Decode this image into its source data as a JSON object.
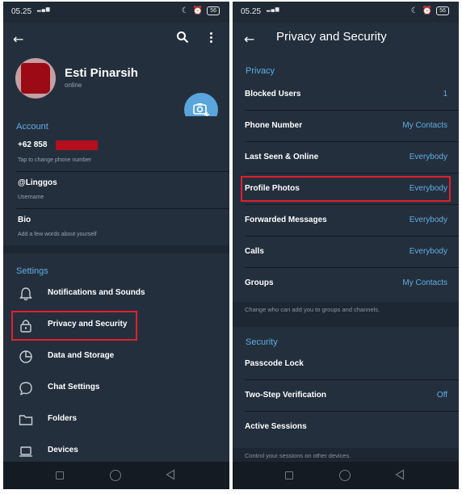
{
  "status_bar": {
    "time": "05.25",
    "battery": "56"
  },
  "left": {
    "profile": {
      "name": "Esti Pinarsih",
      "status": "online"
    },
    "account": {
      "title": "Account",
      "phone": "+62 858",
      "phone_hint": "Tap to change phone number",
      "username": "@Linggos",
      "username_label": "Username",
      "bio": "Bio",
      "bio_hint": "Add a few words about yourself"
    },
    "settings": {
      "title": "Settings",
      "items": [
        {
          "label": "Notifications and Sounds",
          "icon": "bell-icon"
        },
        {
          "label": "Privacy and Security",
          "icon": "lock-icon"
        },
        {
          "label": "Data and Storage",
          "icon": "pie-chart-icon"
        },
        {
          "label": "Chat Settings",
          "icon": "chat-bubble-icon"
        },
        {
          "label": "Folders",
          "icon": "folder-icon"
        },
        {
          "label": "Devices",
          "icon": "laptop-icon"
        }
      ]
    }
  },
  "right": {
    "title": "Privacy and Security",
    "privacy": {
      "title": "Privacy",
      "items": [
        {
          "label": "Blocked Users",
          "value": "1"
        },
        {
          "label": "Phone Number",
          "value": "My Contacts"
        },
        {
          "label": "Last Seen & Online",
          "value": "Everybody"
        },
        {
          "label": "Profile Photos",
          "value": "Everybody"
        },
        {
          "label": "Forwarded Messages",
          "value": "Everybody"
        },
        {
          "label": "Calls",
          "value": "Everybody"
        },
        {
          "label": "Groups",
          "value": "My Contacts"
        }
      ],
      "hint": "Change who can add you to groups and channels."
    },
    "security": {
      "title": "Security",
      "items": [
        {
          "label": "Passcode Lock",
          "value": ""
        },
        {
          "label": "Two-Step Verification",
          "value": "Off"
        },
        {
          "label": "Active Sessions",
          "value": ""
        }
      ],
      "hint": "Control your sessions on other devices."
    }
  },
  "colors": {
    "accent": "#5faee5",
    "highlight": "#e0202c",
    "background": "#1d2733",
    "panel": "#242f3d"
  }
}
